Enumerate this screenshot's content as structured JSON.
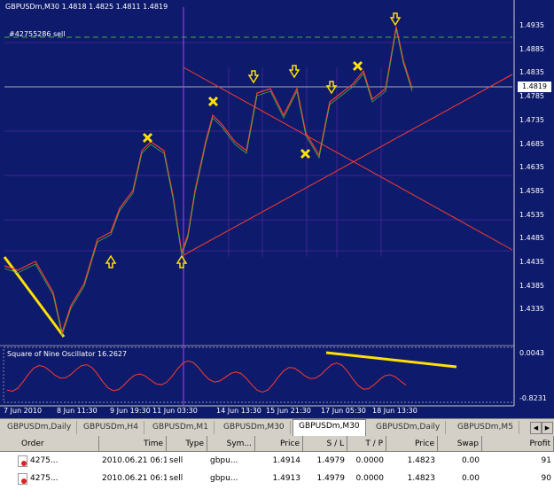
{
  "chart": {
    "title": "GBPUSDm,M30  1.4818 1.4825 1.4811 1.4819",
    "order_label": "#42755286 sell",
    "current_price": "1.4819",
    "price_ticks": [
      "1.4935",
      "1.4885",
      "1.4835",
      "1.4785",
      "1.4735",
      "1.4685",
      "1.4635",
      "1.4585",
      "1.4535",
      "1.4485",
      "1.4435",
      "1.4385",
      "1.4335"
    ],
    "oscillator_label": "Square of Nine Oscillator  16.2627",
    "oscillator_ticks": [
      "0.0043",
      "-0.8231"
    ],
    "date_ticks": [
      "7 Jun 2010",
      "8 Jun 11:30",
      "9 Jun 19:30",
      "11 Jun 03:30",
      "14 Jun 13:30",
      "15 Jun 21:30",
      "17 Jun 05:30",
      "18 Jun 13:30"
    ],
    "colors": {
      "background": "#0e1a6b",
      "grid": "#6a2bb0",
      "line": "#ff3b2f",
      "arrow": "#ffe000"
    }
  },
  "tabs": [
    {
      "label": "GBPUSDm,Daily"
    },
    {
      "label": "GBPUSDm,H4"
    },
    {
      "label": "GBPUSDm,M1"
    },
    {
      "label": "GBPUSDm,M30"
    },
    {
      "label": "GBPUSDm,M30",
      "active": true
    },
    {
      "label": "GBPUSDm,Daily"
    },
    {
      "label": "GBPUSDm,M5"
    }
  ],
  "table": {
    "headers": [
      "Order",
      "Time",
      "Type",
      "Sym...",
      "Price",
      "S / L",
      "T / P",
      "Price",
      "Swap",
      "Profit"
    ],
    "rows": [
      [
        "4275...",
        "2010.06.21 06:13",
        "sell",
        "gbpu...",
        "1.4914",
        "1.4979",
        "0.0000",
        "1.4823",
        "0.00",
        "91"
      ],
      [
        "4275...",
        "2010.06.21 06:13",
        "sell",
        "gbpu...",
        "1.4913",
        "1.4979",
        "0.0000",
        "1.4823",
        "0.00",
        "90"
      ]
    ]
  }
}
